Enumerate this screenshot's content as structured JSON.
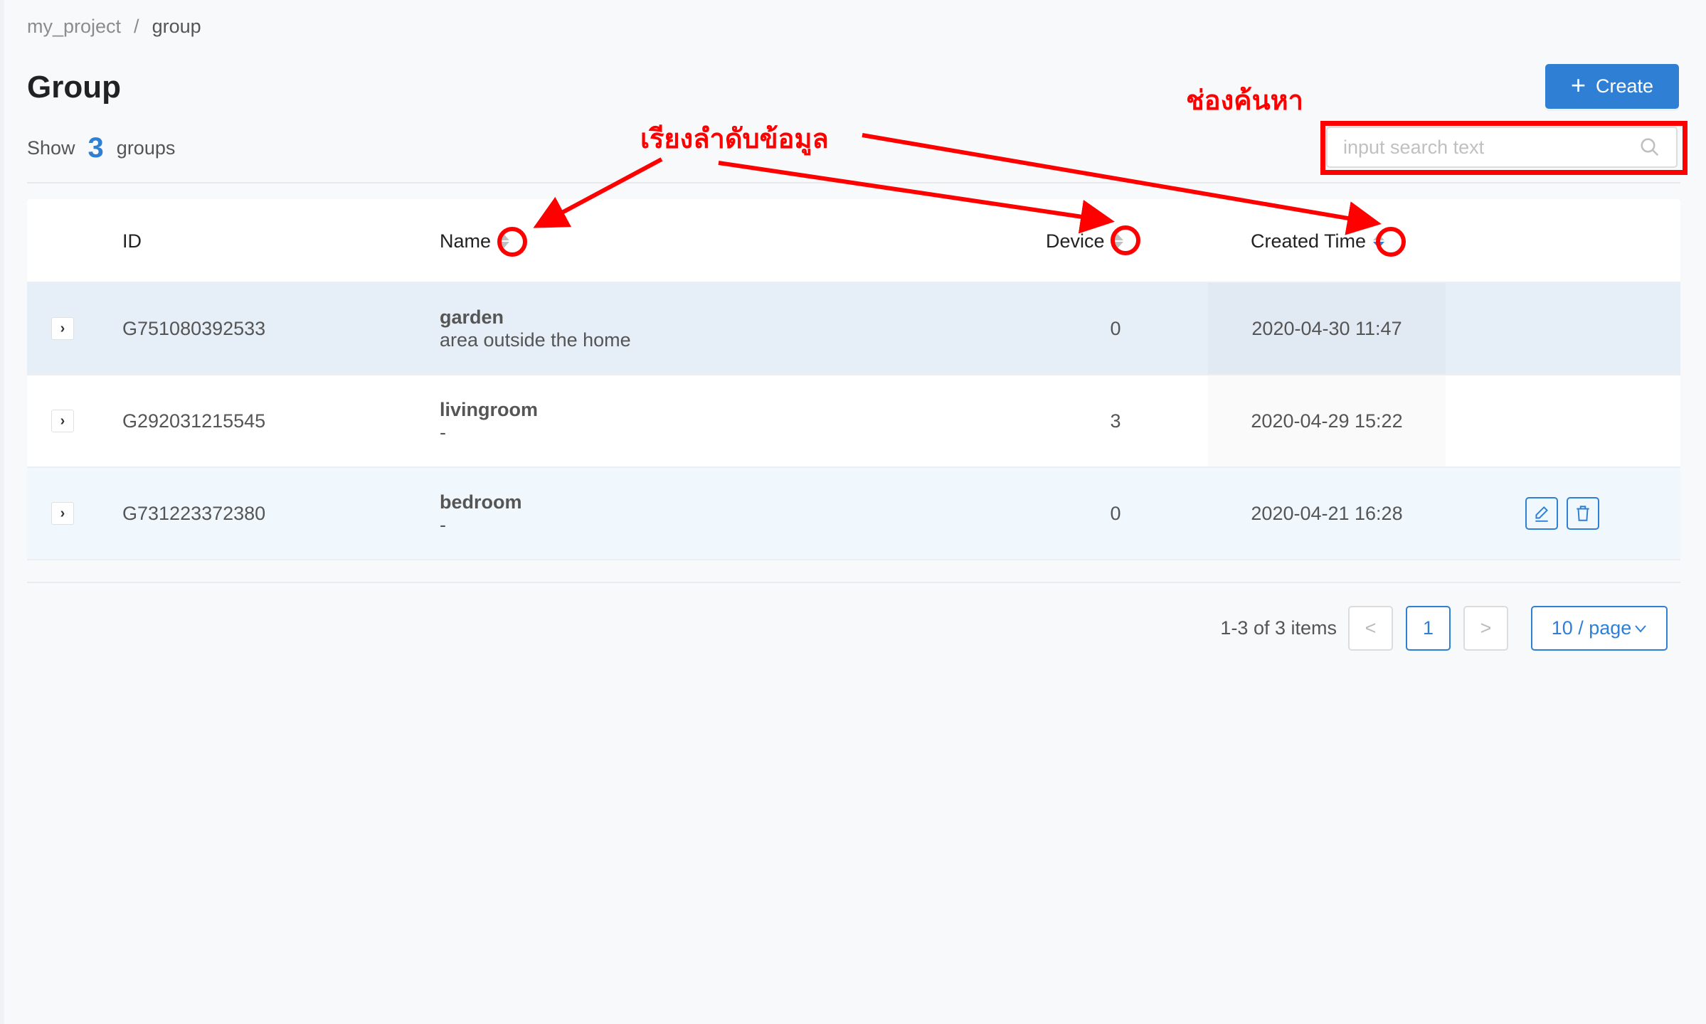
{
  "breadcrumb": [
    {
      "label": "my_project"
    },
    {
      "label": "group"
    }
  ],
  "breadcrumb_separator": "/",
  "page": {
    "title": "Group",
    "summary_prefix": "Show",
    "summary_count": "3",
    "summary_suffix": "groups"
  },
  "toolbar": {
    "create_label": "Create",
    "create_icon": "plus-icon",
    "search_placeholder": "input search text",
    "search_value": "",
    "search_icon": "search-icon"
  },
  "table": {
    "columns": [
      {
        "label": "ID",
        "sortable": false
      },
      {
        "label": "Name",
        "sortable": true,
        "sort": "none"
      },
      {
        "label": "Device",
        "sortable": true,
        "sort": "none"
      },
      {
        "label": "Created Time",
        "sortable": true,
        "sort": "descend"
      }
    ],
    "rows": [
      {
        "id": "G751080392533",
        "name": "garden",
        "description": "area outside the home",
        "device": "0",
        "created": "2020-04-30 11:47",
        "state": "selected"
      },
      {
        "id": "G292031215545",
        "name": "livingroom",
        "description": "-",
        "device": "3",
        "created": "2020-04-29 15:22",
        "state": "normal"
      },
      {
        "id": "G731223372380",
        "name": "bedroom",
        "description": "-",
        "device": "0",
        "created": "2020-04-21 16:28",
        "state": "hover",
        "actions": [
          "edit-icon",
          "delete-icon"
        ]
      }
    ]
  },
  "pagination": {
    "total_text": "1-3 of 3 items",
    "prev": "<",
    "current_page": "1",
    "next": ">",
    "page_size": "10 / page"
  },
  "annotations": {
    "sort_label": "เรียงลำดับข้อมูล",
    "search_label": "ช่องค้นหา",
    "color": "#ff0000"
  },
  "colors": {
    "primary": "#2f7fd4",
    "selected_row": "#e6eef7",
    "hover_row": "#f0f7fd"
  }
}
